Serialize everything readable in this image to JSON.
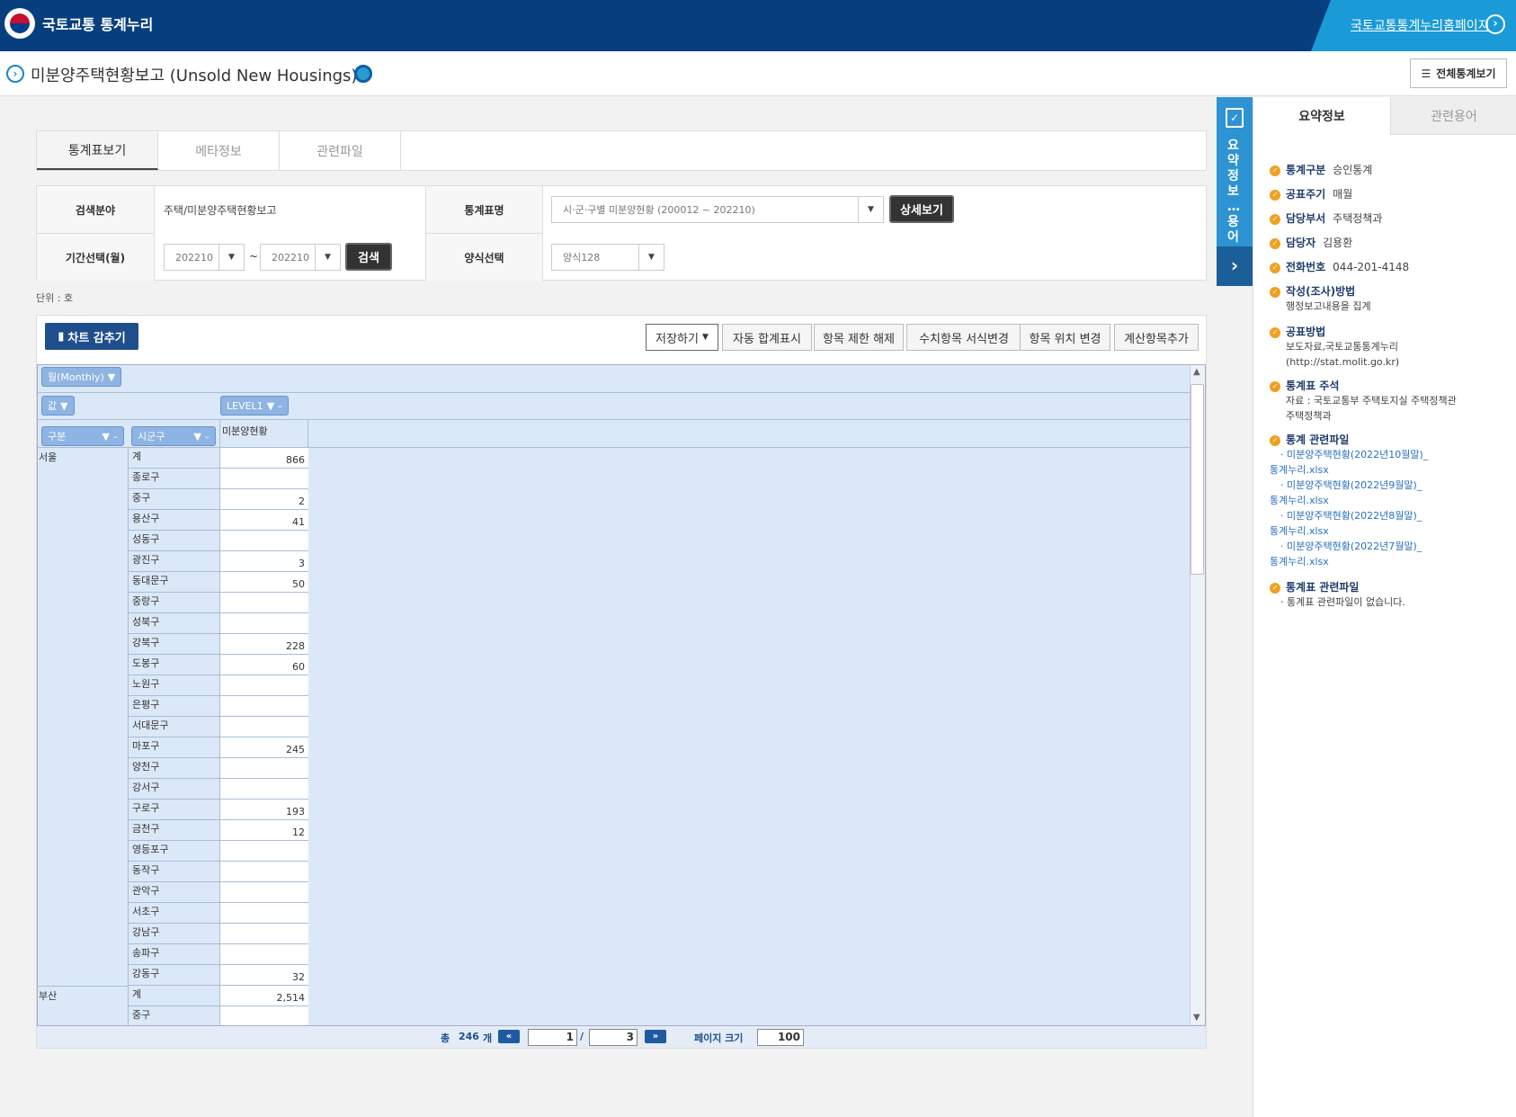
{
  "header": {
    "logo_text": "국토교통 통계누리",
    "home_link": "국토교통통계누리홈페이지"
  },
  "title": {
    "text": "미분양주택현황보고 (Unsold New Housings)",
    "all_stats_button": "전체통계보기"
  },
  "tabs": [
    "통계표보기",
    "메타정보",
    "관련파일"
  ],
  "search": {
    "field_label": "검색분야",
    "field_value": "주택/미분양주택현황보고",
    "stat_name_label": "통계표명",
    "stat_name_value": "시·군·구별 미분양현황 (200012 ~ 202210)",
    "detail_button": "상세보기",
    "period_label": "기간선택(월)",
    "period_from": "202210",
    "period_sep": "~",
    "period_to": "202210",
    "search_button": "검색",
    "format_label": "양식선택",
    "format_value": "양식128"
  },
  "unit_text": "단위 : 호",
  "toolbar": {
    "chart_button": "차트 감추기",
    "save_button": "저장하기",
    "auto_sum": "자동 합계표시",
    "limit_release": "항목 제한 해제",
    "format_change": "수치항목 서식변경",
    "position_change": "항목 위치 변경",
    "calc_add": "계산항목추가"
  },
  "grid": {
    "monthly_pill": "월(Monthly)",
    "value_pill": "값",
    "level_pill": "LEVEL1",
    "gubun_pill": "구분",
    "sigungu_pill": "시군구",
    "column_header": "미분양현황",
    "rows": [
      {
        "group": "서울",
        "name": "계",
        "value": "866"
      },
      {
        "group": "",
        "name": "종로구",
        "value": ""
      },
      {
        "group": "",
        "name": "중구",
        "value": "2"
      },
      {
        "group": "",
        "name": "용산구",
        "value": "41"
      },
      {
        "group": "",
        "name": "성동구",
        "value": ""
      },
      {
        "group": "",
        "name": "광진구",
        "value": "3"
      },
      {
        "group": "",
        "name": "동대문구",
        "value": "50"
      },
      {
        "group": "",
        "name": "중랑구",
        "value": ""
      },
      {
        "group": "",
        "name": "성북구",
        "value": ""
      },
      {
        "group": "",
        "name": "강북구",
        "value": "228"
      },
      {
        "group": "",
        "name": "도봉구",
        "value": "60"
      },
      {
        "group": "",
        "name": "노원구",
        "value": ""
      },
      {
        "group": "",
        "name": "은평구",
        "value": ""
      },
      {
        "group": "",
        "name": "서대문구",
        "value": ""
      },
      {
        "group": "",
        "name": "마포구",
        "value": "245"
      },
      {
        "group": "",
        "name": "양천구",
        "value": ""
      },
      {
        "group": "",
        "name": "강서구",
        "value": ""
      },
      {
        "group": "",
        "name": "구로구",
        "value": "193"
      },
      {
        "group": "",
        "name": "금천구",
        "value": "12"
      },
      {
        "group": "",
        "name": "영등포구",
        "value": ""
      },
      {
        "group": "",
        "name": "동작구",
        "value": ""
      },
      {
        "group": "",
        "name": "관악구",
        "value": ""
      },
      {
        "group": "",
        "name": "서초구",
        "value": ""
      },
      {
        "group": "",
        "name": "강남구",
        "value": ""
      },
      {
        "group": "",
        "name": "송파구",
        "value": ""
      },
      {
        "group": "",
        "name": "강동구",
        "value": "32"
      },
      {
        "group": "부산",
        "name": "계",
        "value": "2,514"
      },
      {
        "group": "",
        "name": "중구",
        "value": ""
      }
    ]
  },
  "pager": {
    "total_label": "총",
    "total_count": "246",
    "count_unit": "개",
    "current_page": "1",
    "sep": "/",
    "total_pages": "3",
    "page_size_label": "페이지 크기",
    "page_size": "100"
  },
  "side_tab": {
    "label": "요약정보 … 용어"
  },
  "right_panel": {
    "tab_summary": "요약정보",
    "tab_terms": "관련용어",
    "items": [
      {
        "key": "통계구분",
        "value": "승인통계"
      },
      {
        "key": "공표주기",
        "value": "매월"
      },
      {
        "key": "담당부서",
        "value": "주택정책과"
      },
      {
        "key": "담당자",
        "value": "김용환"
      },
      {
        "key": "전화번호",
        "value": "044-201-4148"
      }
    ],
    "method_key": "작성(조사)방법",
    "method_value": "행정보고내용을 집계",
    "publish_key": "공표방법",
    "publish_value1": "보도자료,국토교통통계누리",
    "publish_value2": "(http://stat.molit.go.kr)",
    "note_key": "통계표 주석",
    "note_value1": "자료 : 국토교통부 주택토지실 주택정책관",
    "note_value2": "주택정책과",
    "files_key": "통계 관련파일",
    "files": [
      {
        "line1": "· 미분양주택현황(2022년10월말)_",
        "line2": "통계누리.xlsx"
      },
      {
        "line1": "· 미분양주택현황(2022년9월말)_",
        "line2": "통계누리.xlsx"
      },
      {
        "line1": "· 미분양주택현황(2022년8월말)_",
        "line2": "통계누리.xlsx"
      },
      {
        "line1": "· 미분양주택현황(2022년7월말)_",
        "line2": "통계누리.xlsx"
      }
    ],
    "table_files_key": "통계표 관련파일",
    "table_files_value": "· 통계표 관련파일이 없습니다."
  }
}
